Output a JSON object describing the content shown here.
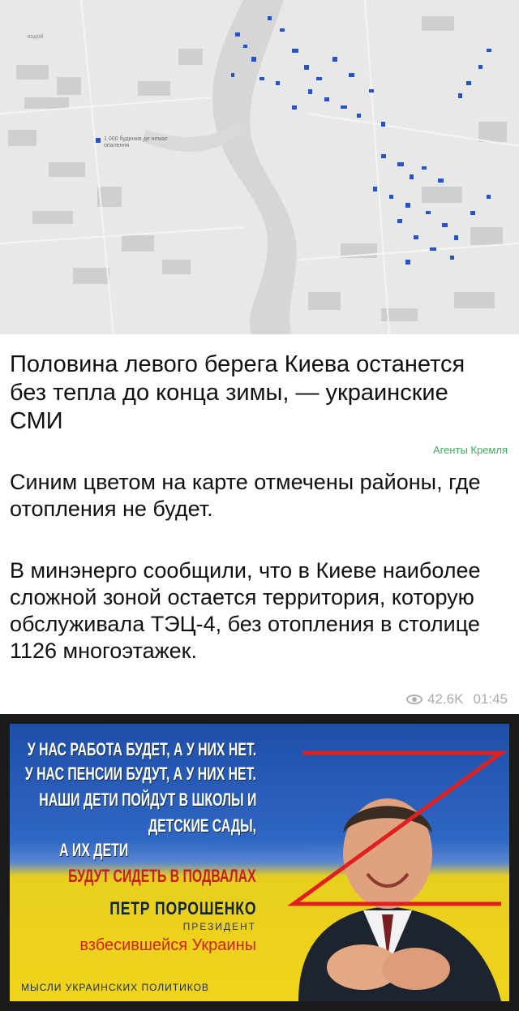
{
  "map": {
    "area_label": "водой",
    "legend_text": "1 000 будинків де немає опалення"
  },
  "post": {
    "headline": "Половина левого берега Киева останется без тепла до конца зимы, — украинские СМИ",
    "source": "Агенты Кремля",
    "paragraph1": "Синим цветом на карте отмечены районы, где отопления не будет.",
    "paragraph2": "В минэнерго сообщили, что в Киеве наиболее сложной зоной остается территория, которую обслуживала ТЭЦ-4, без отопления в столице 1126 многоэтажек.",
    "views": "42.6K",
    "time": "01:45"
  },
  "poster": {
    "line1": "У НАС РАБОТА БУДЕТ, А У НИХ НЕТ.",
    "line2": "У НАС ПЕНСИИ БУДУТ, А У НИХ НЕТ.",
    "line3": "НАШИ ДЕТИ ПОЙДУТ В ШКОЛЫ И",
    "line4": "ДЕТСКИЕ САДЫ,",
    "line5": "А ИХ ДЕТИ",
    "line6": "БУДУТ СИДЕТЬ В ПОДВАЛАХ",
    "author": "ПЕТР ПОРОШЕНКО",
    "position": "ПРЕЗИДЕНТ",
    "country": "взбесившейся Украины",
    "footer": "МЫСЛИ УКРАИНСКИХ ПОЛИТИКОВ"
  },
  "icons": {
    "views": "eye-icon"
  },
  "colors": {
    "heating_off": "#2553c9",
    "source_link": "#3ab15a",
    "z_mark": "#e02020"
  }
}
